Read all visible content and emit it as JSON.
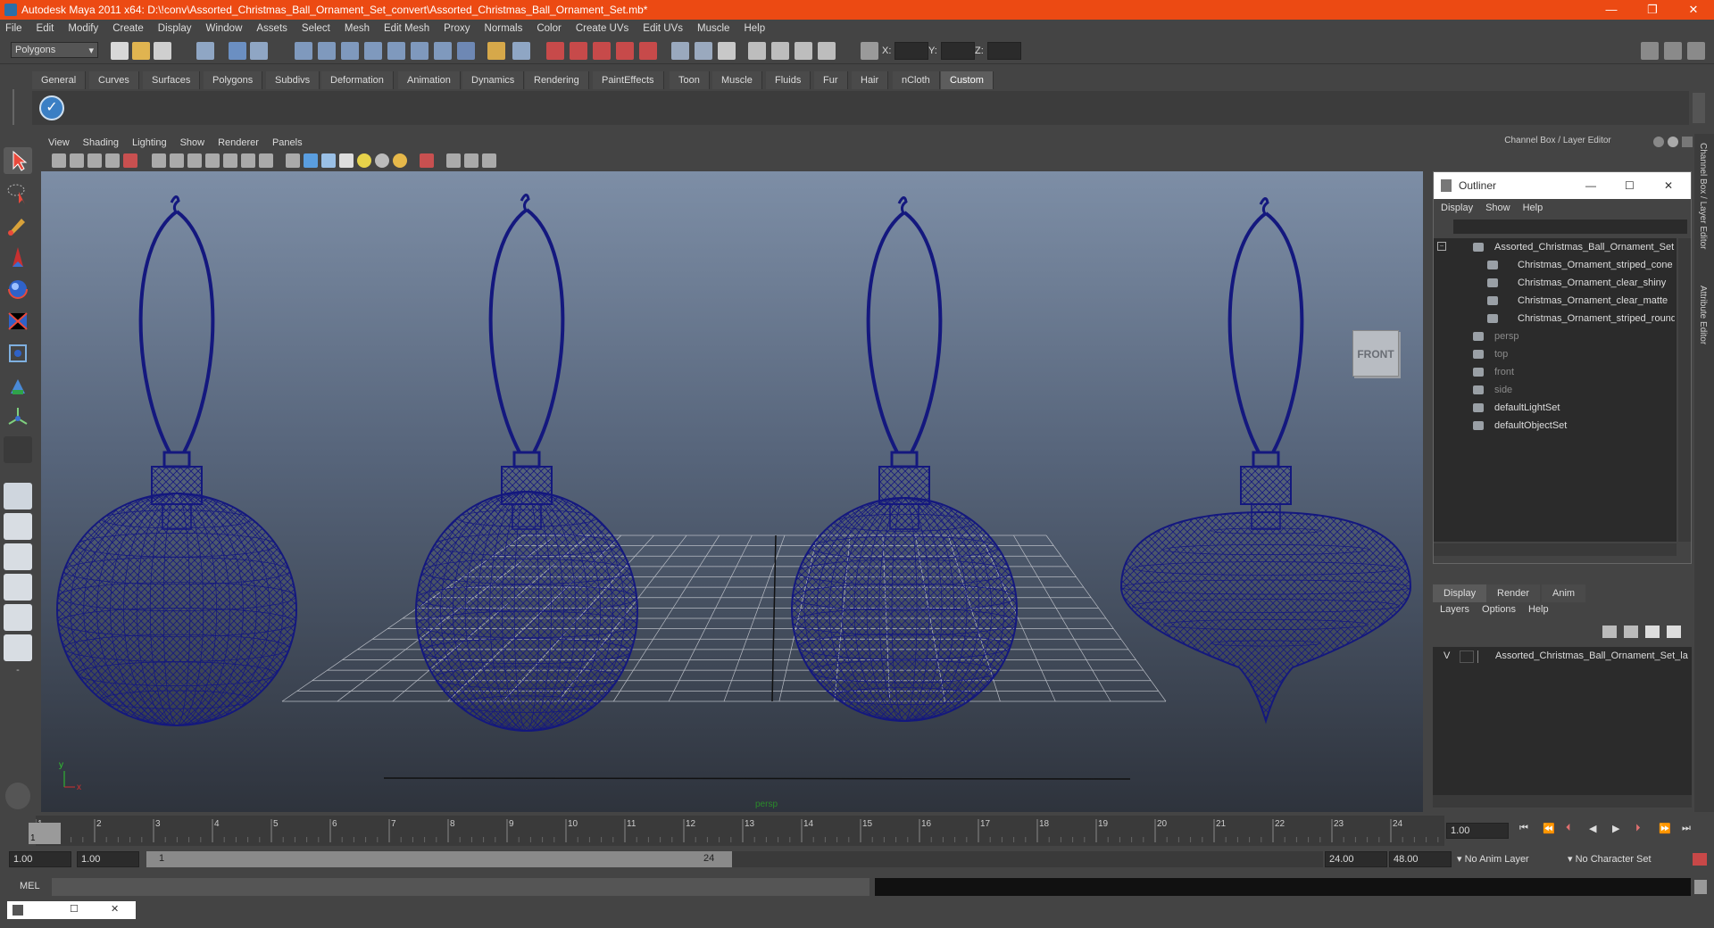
{
  "window": {
    "title": "Autodesk Maya 2011 x64: D:\\!conv\\Assorted_Christmas_Ball_Ornament_Set_convert\\Assorted_Christmas_Ball_Ornament_Set.mb*",
    "minimize": "—",
    "maximize": "❐",
    "close": "✕"
  },
  "menubar": [
    "File",
    "Edit",
    "Modify",
    "Create",
    "Display",
    "Window",
    "Assets",
    "Select",
    "Mesh",
    "Edit Mesh",
    "Proxy",
    "Normals",
    "Color",
    "Create UVs",
    "Edit UVs",
    "Muscle",
    "Help"
  ],
  "statusline": {
    "mode": "Polygons",
    "x_label": "X:",
    "y_label": "Y:",
    "z_label": "Z:"
  },
  "shelf": {
    "tabs": [
      "General",
      "Curves",
      "Surfaces",
      "Polygons",
      "Subdivs",
      "Deformation",
      "Animation",
      "Dynamics",
      "Rendering",
      "PaintEffects",
      "Toon",
      "Muscle",
      "Fluids",
      "Fur",
      "Hair",
      "nCloth",
      "Custom"
    ],
    "active": "Custom"
  },
  "viewport": {
    "menu": [
      "View",
      "Shading",
      "Lighting",
      "Show",
      "Renderer",
      "Panels"
    ],
    "cube_label": "FRONT",
    "camera_label": "persp",
    "axis_x": "x",
    "axis_y": "y"
  },
  "channelbox": {
    "header": "Channel Box / Layer Editor",
    "side_tabs": [
      "Channel Box / Layer Editor",
      "Attribute Editor"
    ]
  },
  "outliner": {
    "title": "Outliner",
    "menu": [
      "Display",
      "Show",
      "Help"
    ],
    "items": [
      {
        "label": "Assorted_Christmas_Ball_Ornament_Set",
        "indent": 0,
        "dim": false
      },
      {
        "label": "Christmas_Ornament_striped_cone",
        "indent": 1,
        "dim": false
      },
      {
        "label": "Christmas_Ornament_clear_shiny",
        "indent": 1,
        "dim": false
      },
      {
        "label": "Christmas_Ornament_clear_matte",
        "indent": 1,
        "dim": false
      },
      {
        "label": "Christmas_Ornament_striped_round",
        "indent": 1,
        "dim": false
      },
      {
        "label": "persp",
        "indent": 0,
        "dim": true
      },
      {
        "label": "top",
        "indent": 0,
        "dim": true
      },
      {
        "label": "front",
        "indent": 0,
        "dim": true
      },
      {
        "label": "side",
        "indent": 0,
        "dim": true
      },
      {
        "label": "defaultLightSet",
        "indent": 0,
        "dim": false
      },
      {
        "label": "defaultObjectSet",
        "indent": 0,
        "dim": false
      }
    ]
  },
  "layers": {
    "tabs": [
      "Display",
      "Render",
      "Anim"
    ],
    "menu": [
      "Layers",
      "Options",
      "Help"
    ],
    "visible_flag": "V",
    "layer_name": "Assorted_Christmas_Ball_Ornament_Set_la"
  },
  "timeline": {
    "ticks": [
      "1",
      "2",
      "3",
      "4",
      "5",
      "6",
      "7",
      "8",
      "9",
      "10",
      "11",
      "12",
      "13",
      "14",
      "15",
      "16",
      "17",
      "18",
      "19",
      "20",
      "21",
      "22",
      "23",
      "24"
    ],
    "current_frame_label": "1",
    "current_time": "1.00"
  },
  "range": {
    "start_time": "1.00",
    "playback_start": "1.00",
    "slider_start": "1",
    "slider_end": "24",
    "playback_end": "24.00",
    "end_time": "48.00",
    "anim_layer": "No Anim Layer",
    "character_set": "No Character Set"
  },
  "cmdline": {
    "label": "MEL"
  }
}
